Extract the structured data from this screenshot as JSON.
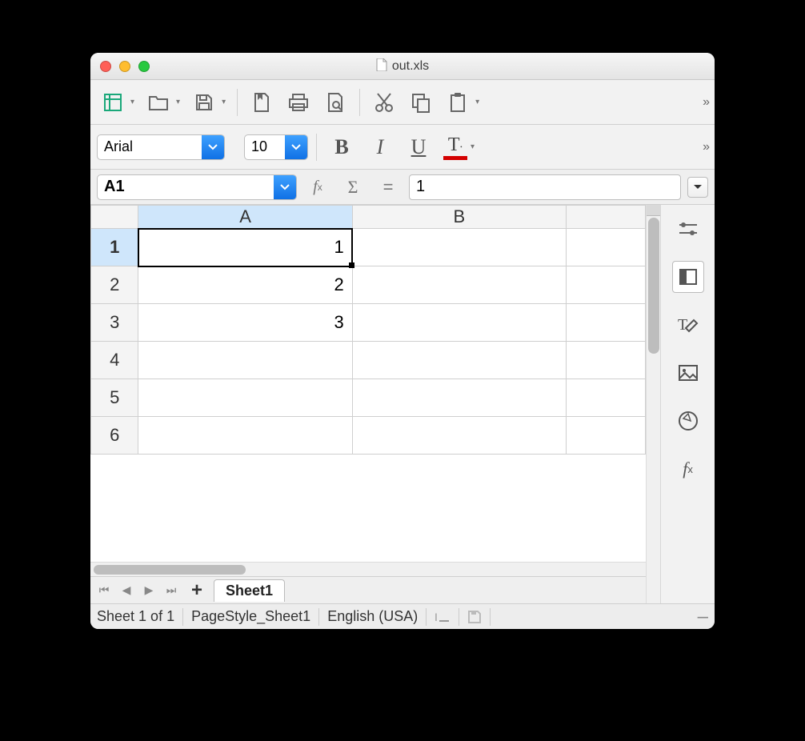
{
  "title": "out.xls",
  "font": {
    "name": "Arial",
    "size": "10"
  },
  "cellref": "A1",
  "formula": "1",
  "columns": [
    "A",
    "B"
  ],
  "rows": [
    "1",
    "2",
    "3",
    "4",
    "5",
    "6"
  ],
  "cells": {
    "A1": "1",
    "A2": "2",
    "A3": "3"
  },
  "selected_cell": "A1",
  "sheet_tab": "Sheet1",
  "status": {
    "sheet_of": "Sheet 1 of 1",
    "pagestyle": "PageStyle_Sheet1",
    "language": "English (USA)"
  }
}
